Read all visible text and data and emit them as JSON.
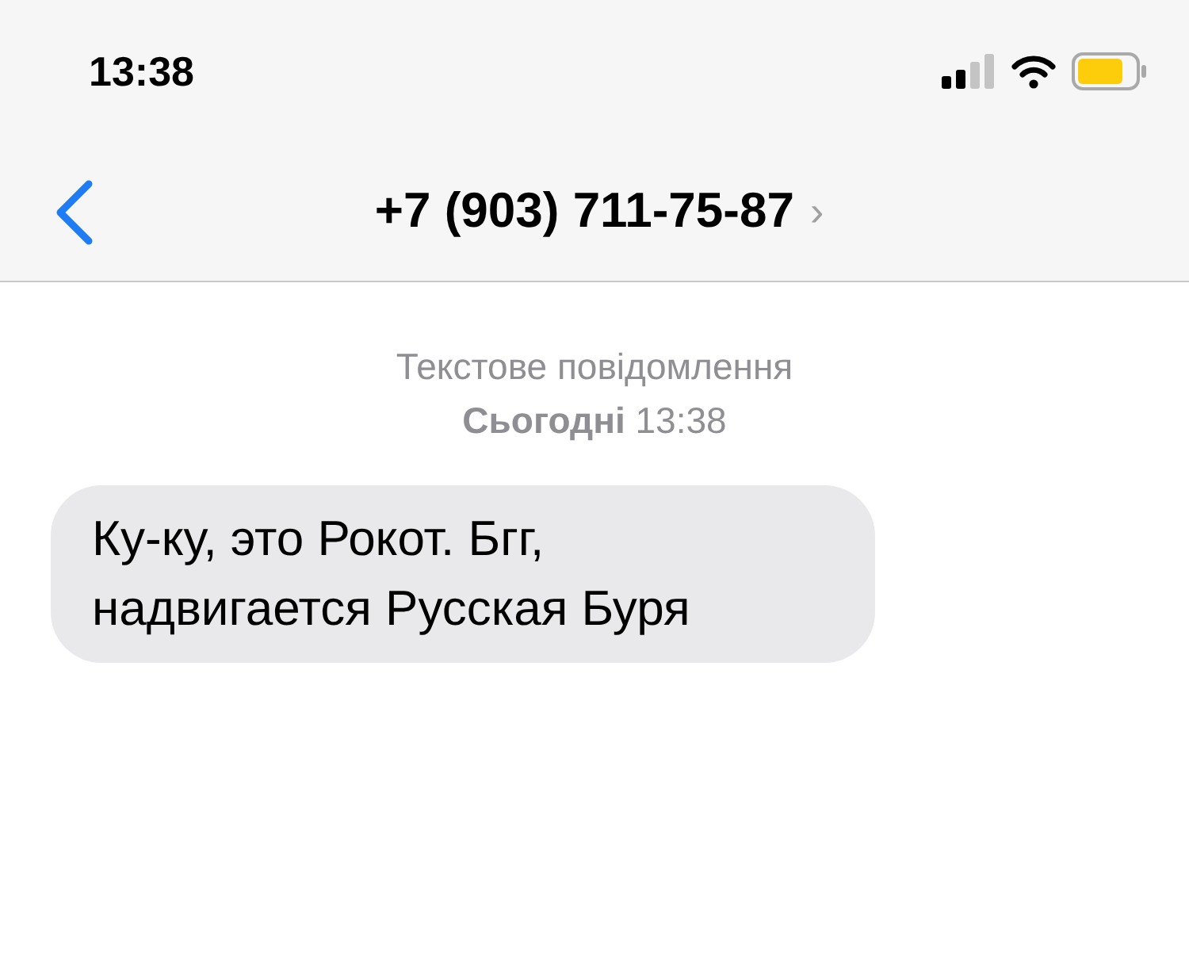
{
  "status_bar": {
    "time": "13:38"
  },
  "header": {
    "title": "+7 (903) 711-75-87",
    "chevron": "›"
  },
  "messages_meta": {
    "type": "Текстове повідомлення",
    "timestamp": "**Сьогодні** 13:38"
  },
  "messages": [
    {
      "kind": "incoming",
      "text": "Ку-ку, это Рокот. Бгг, надвигается Русская Буря"
    }
  ]
}
